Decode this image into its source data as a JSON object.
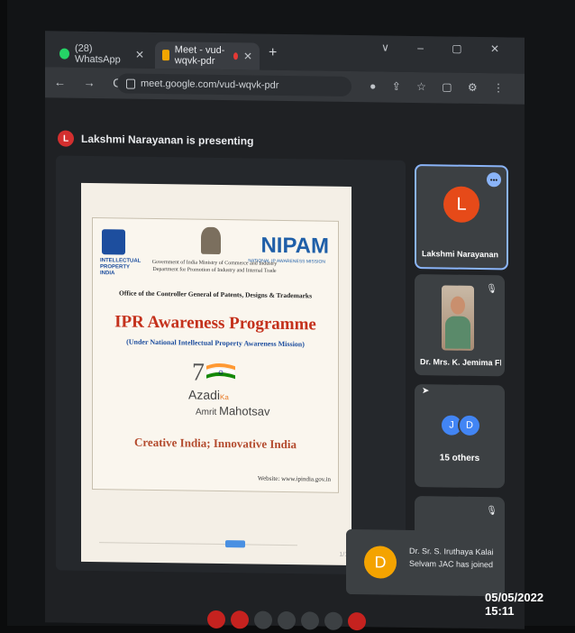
{
  "browser": {
    "tabs": [
      {
        "label": "(28) WhatsApp",
        "favicon_color": "#25d366"
      },
      {
        "label": "Meet - vud-wqvk-pdr",
        "favicon_color": "#f2a600"
      }
    ],
    "new_tab": "+",
    "window_controls": "∨ – ▢ ✕",
    "nav_buttons": "← → C",
    "url": "meet.google.com/vud-wqvk-pdr",
    "address_icons": "● ⇪ ☆ ▢ ⚙ ⋮"
  },
  "meet": {
    "presenter_initial": "L",
    "presenting_text": "Lakshmi Narayanan is presenting",
    "tiles": [
      {
        "initial": "L",
        "name": "Lakshmi Narayanan"
      },
      {
        "name": "Dr. Mrs. K. Jemima Flore..."
      },
      {
        "initials": [
          "J",
          "D"
        ],
        "name": "15 others"
      }
    ],
    "toast": {
      "initial": "D",
      "message": "Dr. Sr. S. Iruthaya Kalai Selvam JAC has joined"
    }
  },
  "slide": {
    "ip_logo_text": "INTELLECTUAL PROPERTY INDIA",
    "govt_lines": "Government of India Ministry of Commerce and Industry Department for Promotion of Industry and Internal Trade",
    "nipam": "NIPAM",
    "nipam_sub": "NATIONAL IP AWARENESS MISSION",
    "office": "Office of the Controller General of Patents, Designs & Trademarks",
    "title": "IPR Awareness Programme",
    "subtitle": "(Under National Intellectual Property Awareness Mission)",
    "azadi": "Azadi",
    "ka": "Ka",
    "amrit": "Amrit",
    "mahotsav": "Mahotsav",
    "tagline": "Creative India; Innovative India",
    "website": "Website: www.ipindia.gov.in",
    "page": "1/13"
  },
  "overlay": {
    "timestamp": "05/05/2022  15:11"
  },
  "colors": {
    "accent": "#8ab4f8",
    "title_red": "#c4311c",
    "nipam_blue": "#1f5fa8"
  }
}
